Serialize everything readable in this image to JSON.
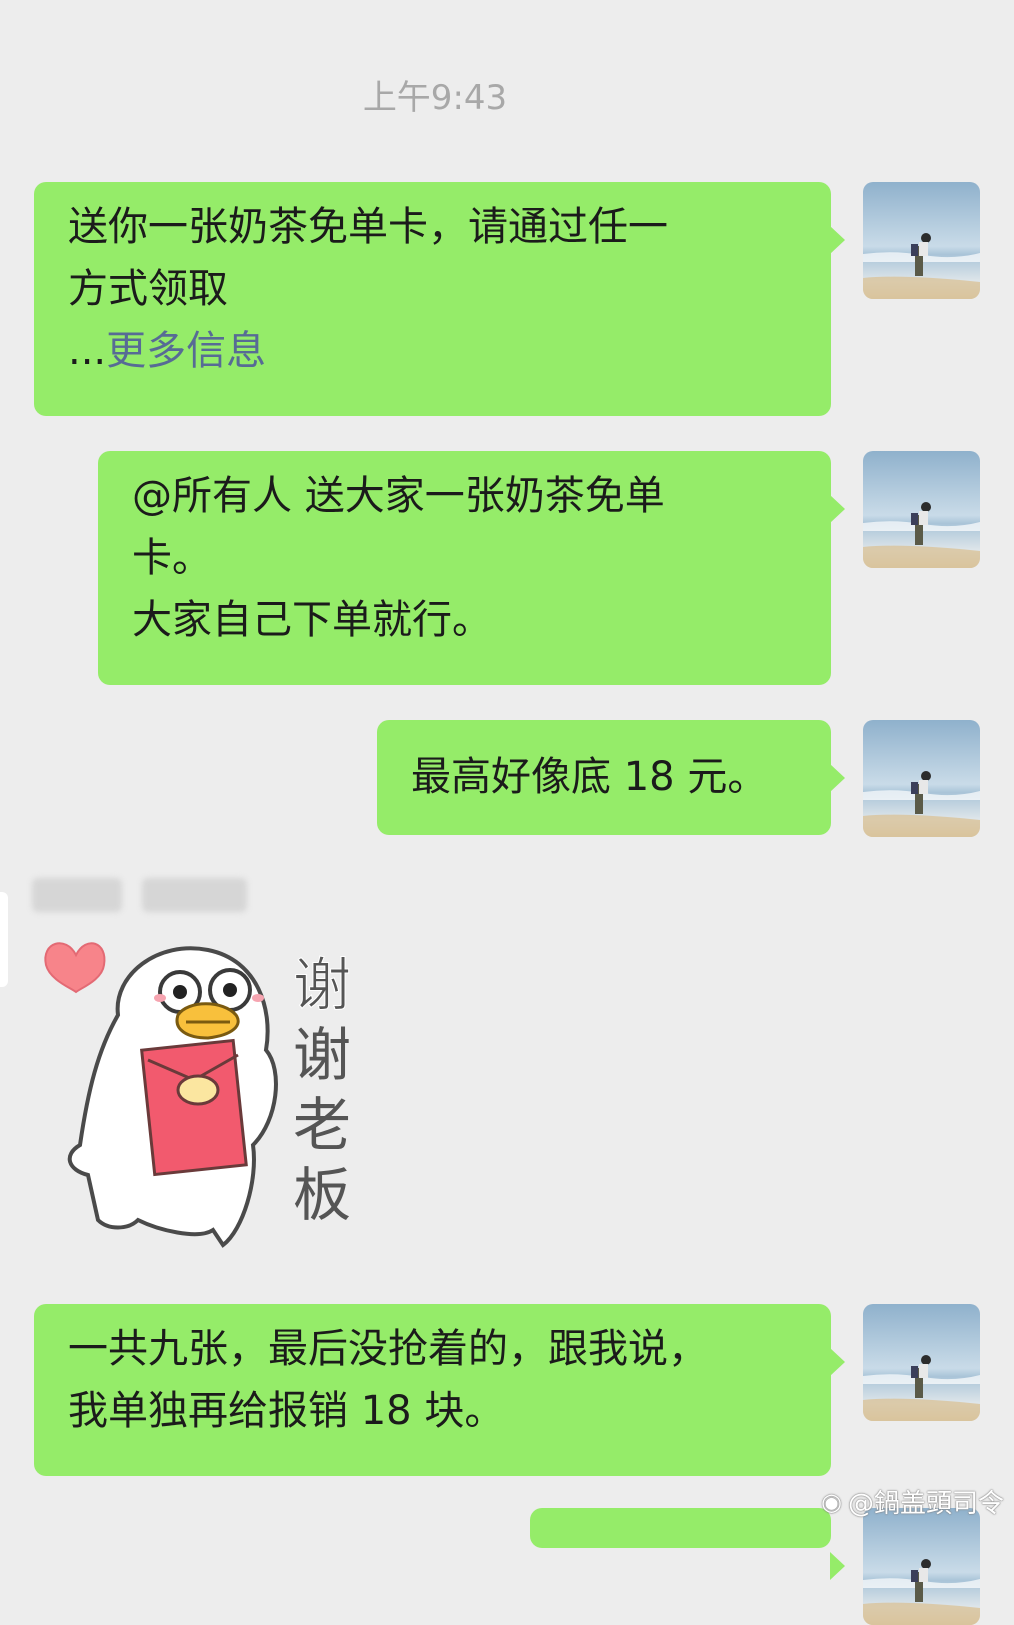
{
  "chat": {
    "timestamp": "上午9:43",
    "messages": [
      {
        "lines": [
          "送你一张奶茶免单卡，请通过任一",
          "方式领取"
        ],
        "more_prefix": "...",
        "more_link": "更多信息"
      },
      {
        "lines": [
          "@所有人  送大家一张奶茶免单",
          "卡。",
          "大家自己下单就行。"
        ]
      },
      {
        "lines": [
          "最高好像底 18 元。"
        ]
      },
      {
        "lines": [
          "一共九张，最后没抢着的，跟我说，",
          "我单独再给报销 18 块。"
        ]
      }
    ],
    "sticker": {
      "text_chars": [
        "谢",
        "谢",
        "老",
        "板"
      ]
    }
  },
  "watermark": {
    "icon": "weibo-icon",
    "text": "@鍋盖頭司令"
  },
  "colors": {
    "background": "#ededed",
    "bubble": "#95ec69",
    "link": "#576b95"
  }
}
